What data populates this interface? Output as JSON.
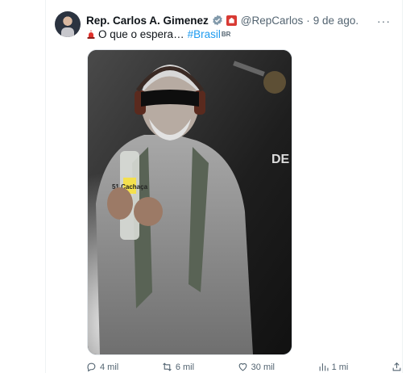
{
  "tweet": {
    "author_name": "Rep. Carlos A. Gimenez",
    "handle": "@RepCarlos",
    "separator": "·",
    "date": "9 de ago.",
    "more": "···",
    "text": "O que o espera…",
    "hashtag": "#Brasil",
    "hashtag_suffix": "BR",
    "media_label": "51 Cachaça",
    "verified_color": "#829aab",
    "hashtag_color": "#1d9bf0"
  },
  "actions": {
    "replies": "4 mil",
    "retweets": "6 mil",
    "likes": "30 mil",
    "views": "1 mi"
  }
}
